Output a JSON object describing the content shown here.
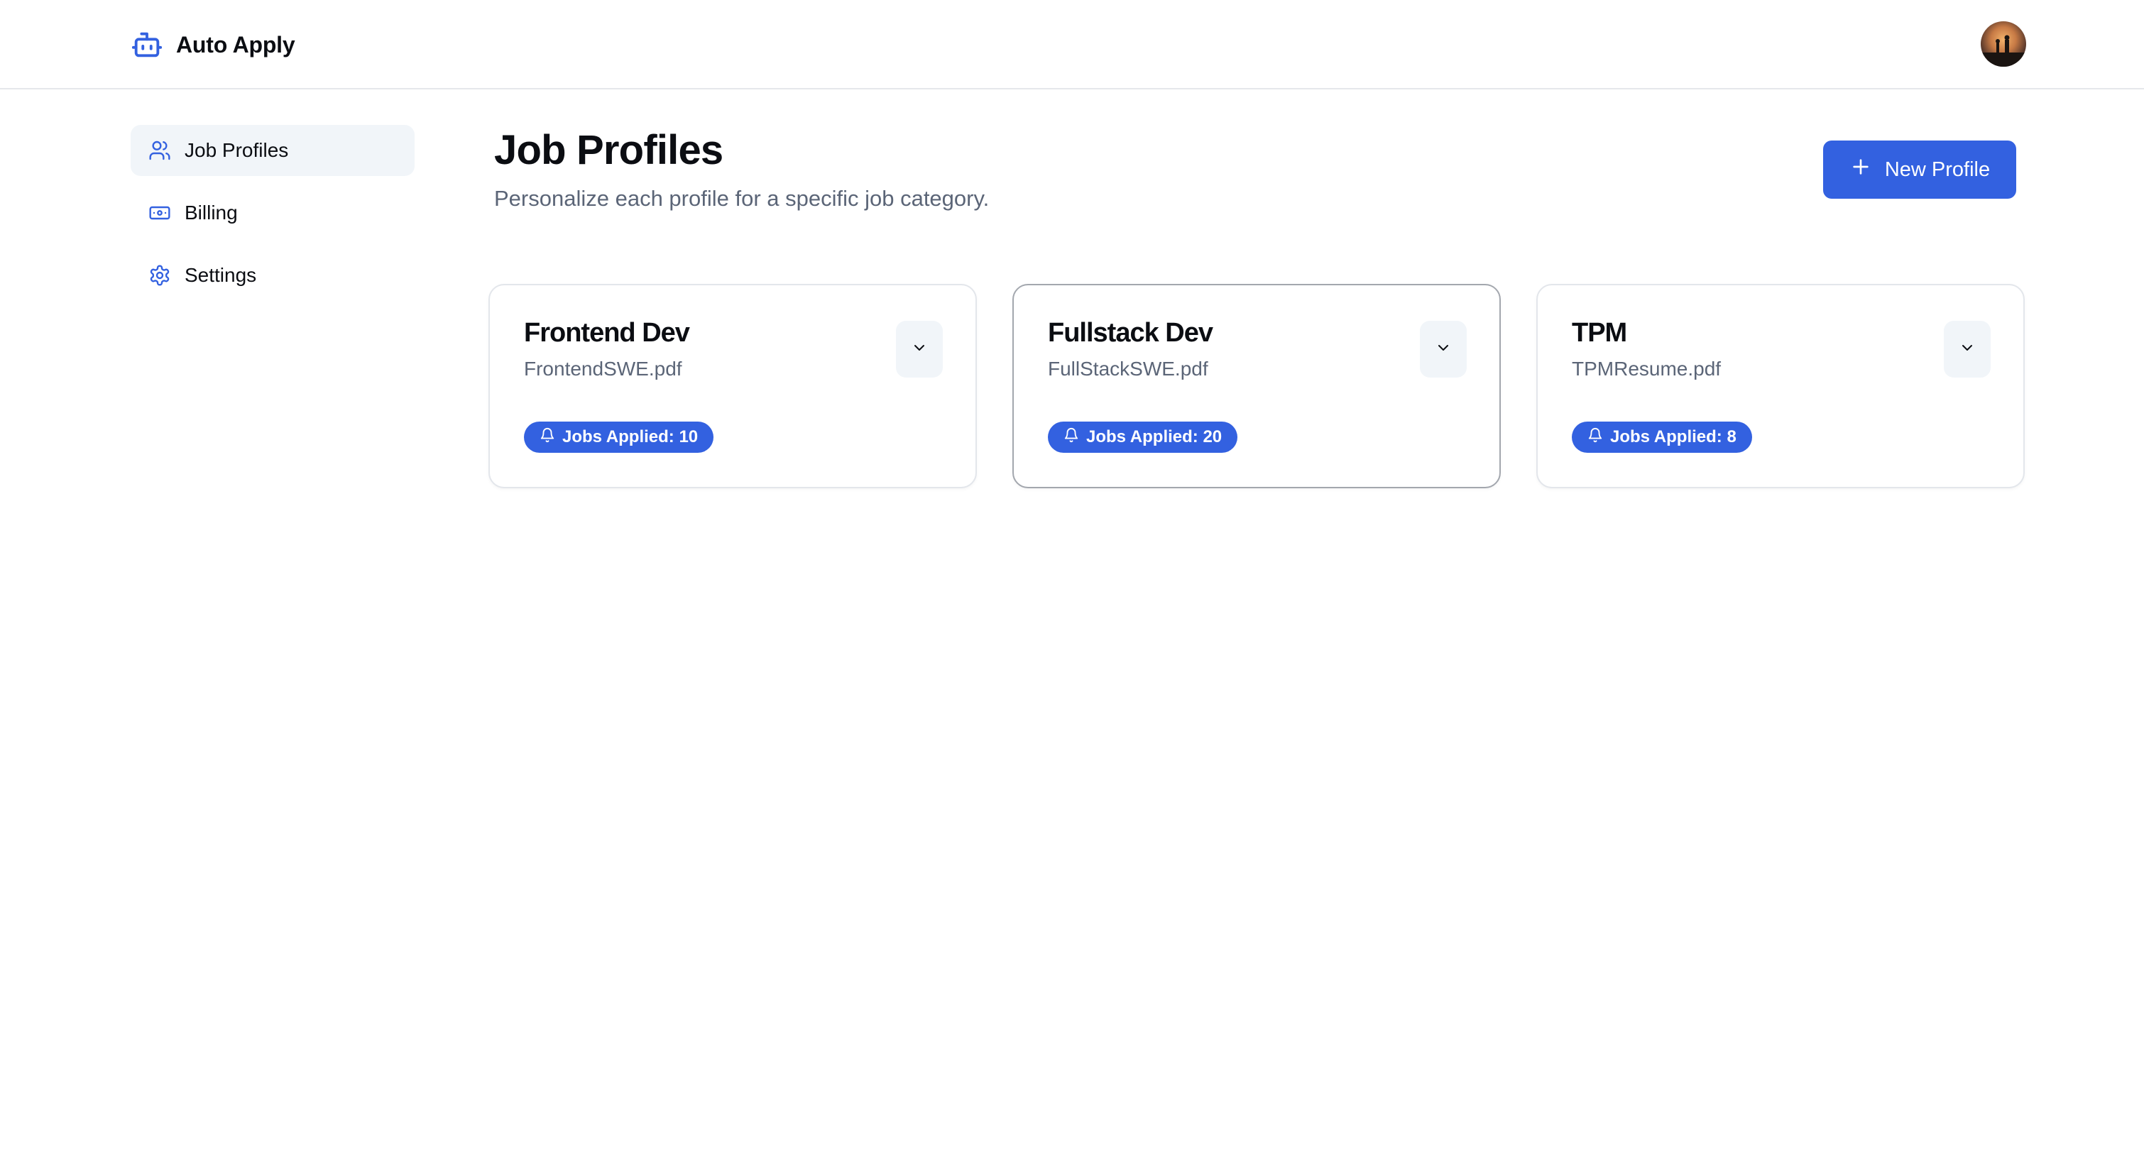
{
  "header": {
    "app_name": "Auto Apply",
    "brand_icon": "robot-icon",
    "avatar": "user-avatar"
  },
  "sidebar": {
    "items": [
      {
        "label": "Job Profiles",
        "icon": "users-icon",
        "active": true
      },
      {
        "label": "Billing",
        "icon": "banknote-icon",
        "active": false
      },
      {
        "label": "Settings",
        "icon": "gear-icon",
        "active": false
      }
    ]
  },
  "main": {
    "title": "Job Profiles",
    "subtitle": "Personalize each profile for a specific job category.",
    "new_button_label": "New Profile",
    "new_button_icon": "plus-icon",
    "profiles": [
      {
        "title": "Frontend Dev",
        "file": "FrontendSWE.pdf",
        "badge": "Jobs Applied: 10",
        "selected": false
      },
      {
        "title": "Fullstack Dev",
        "file": "FullStackSWE.pdf",
        "badge": "Jobs Applied: 20",
        "selected": true
      },
      {
        "title": "TPM",
        "file": "TPMResume.pdf",
        "badge": "Jobs Applied: 8",
        "selected": false
      }
    ]
  },
  "colors": {
    "accent": "#3361e0",
    "muted_text": "#5b6577",
    "active_nav_bg": "#f1f5f9"
  }
}
